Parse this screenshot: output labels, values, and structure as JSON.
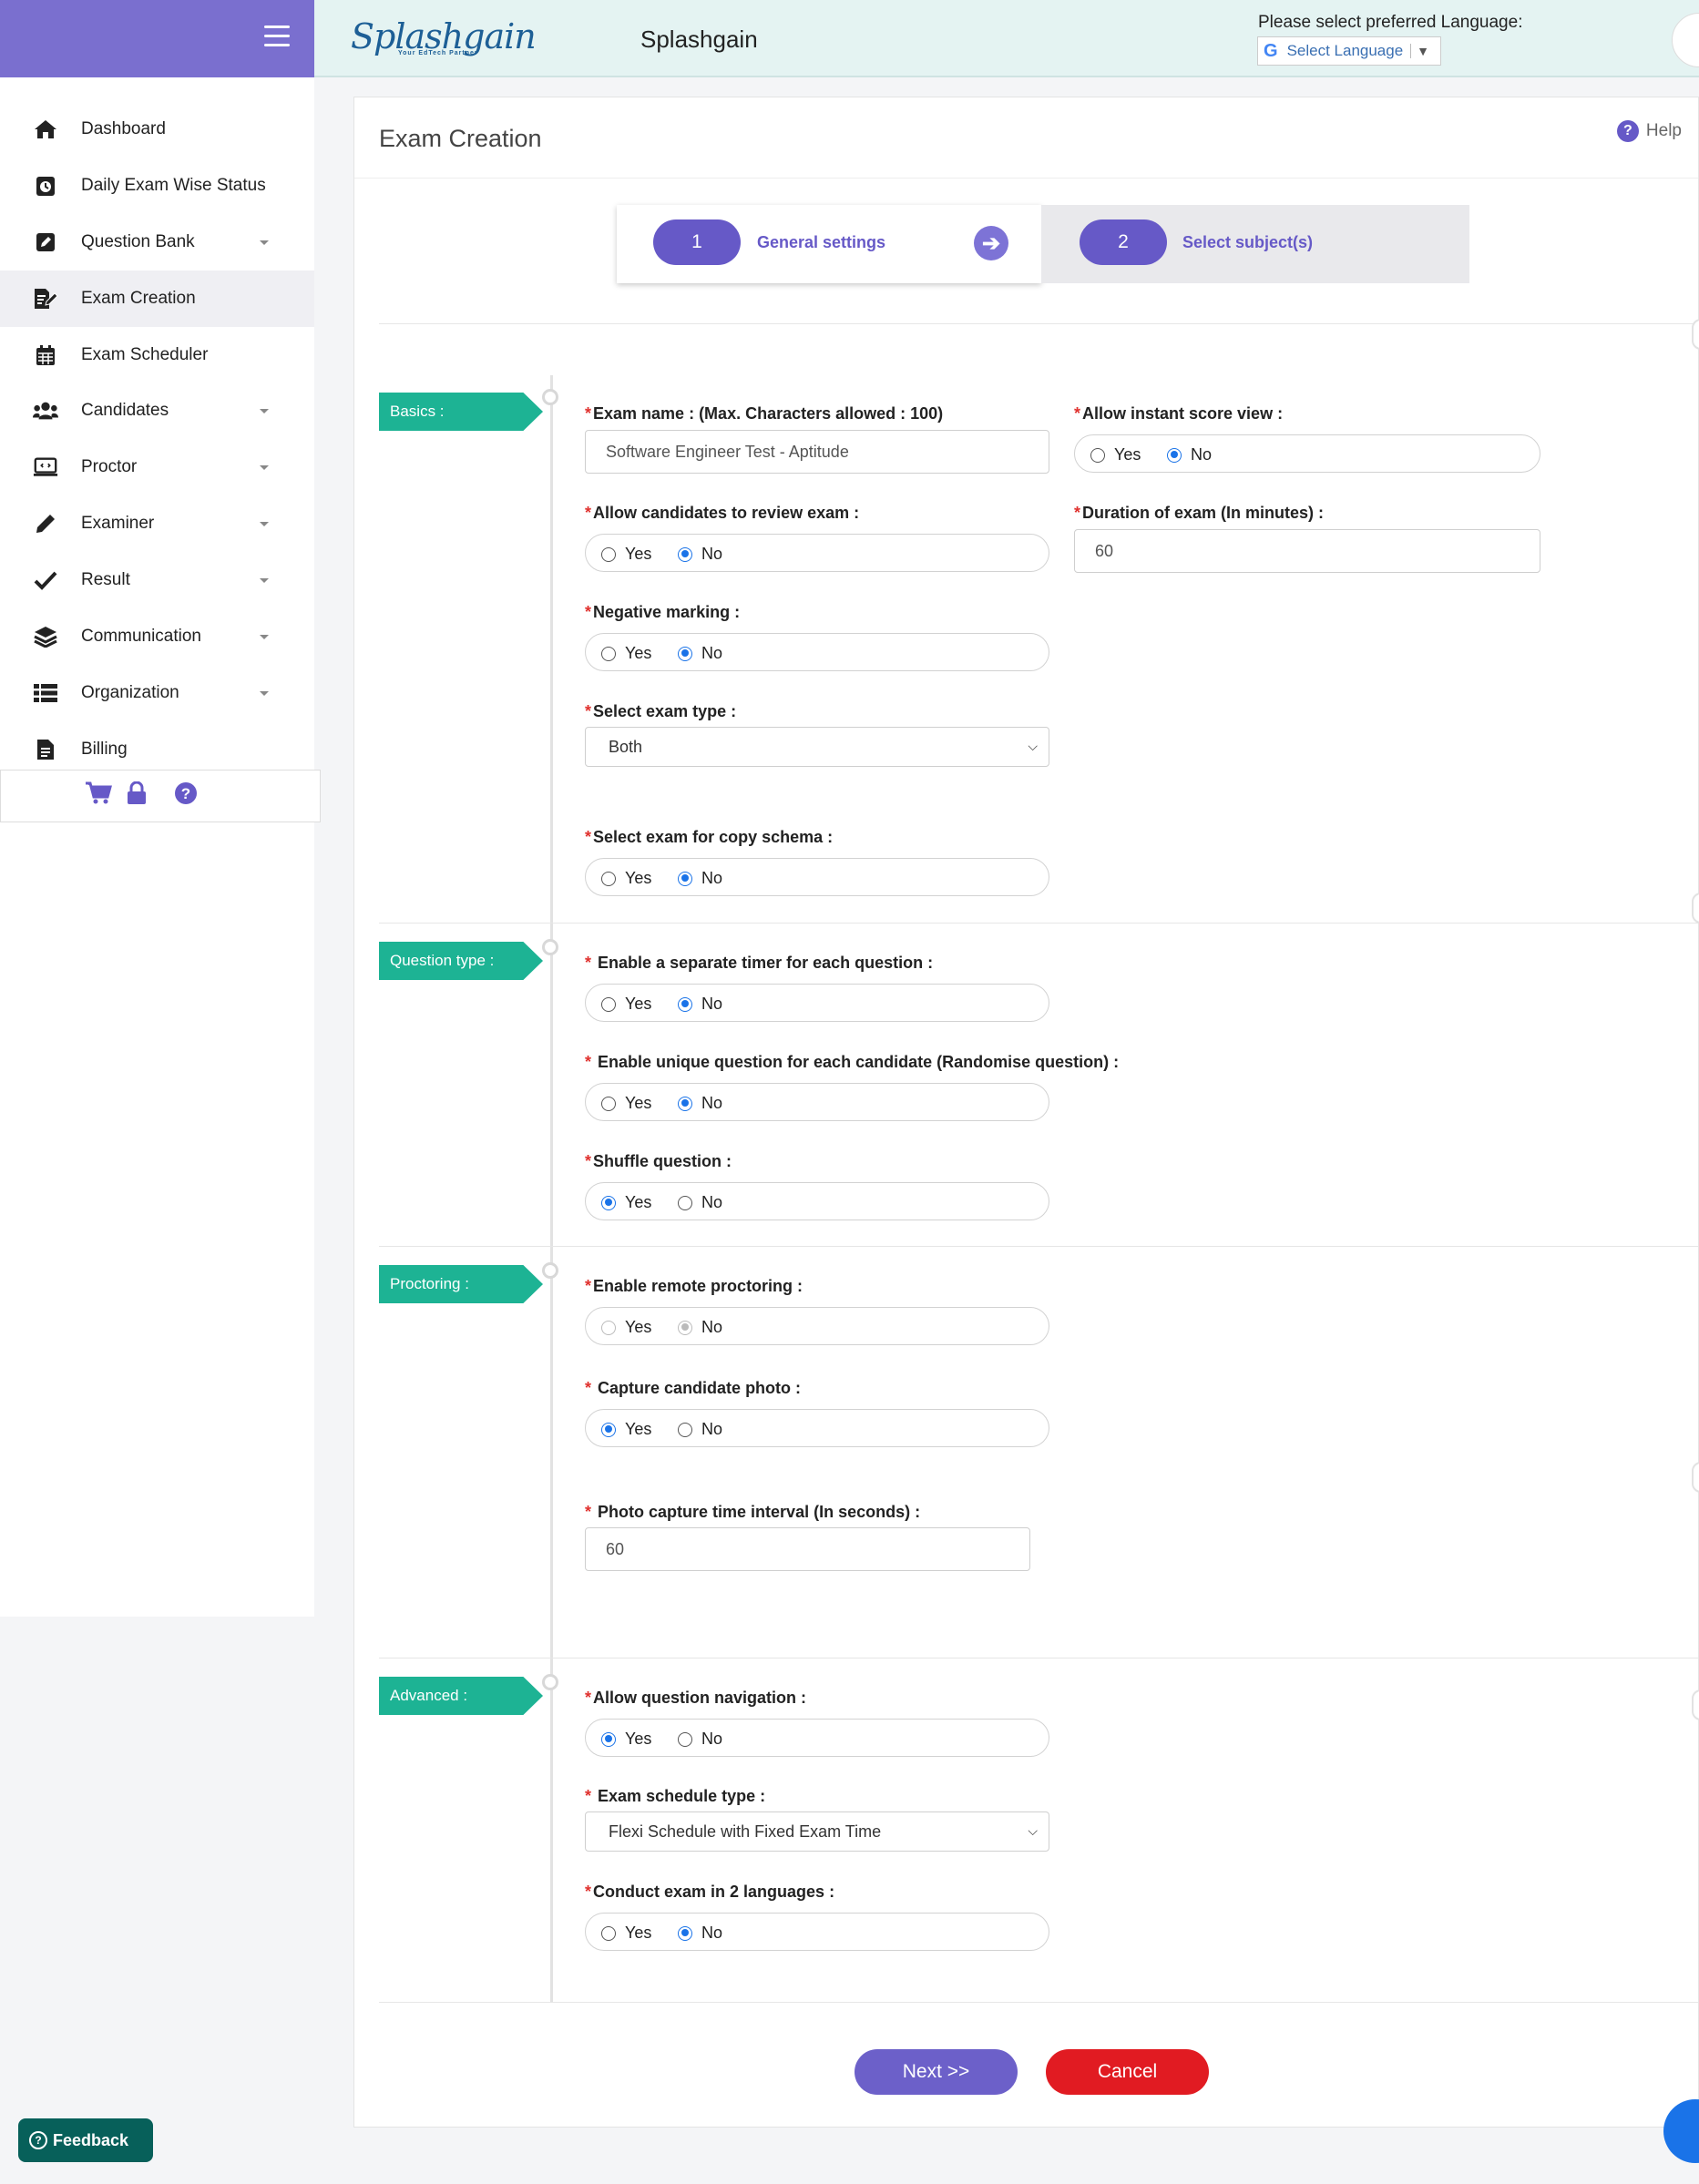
{
  "header": {
    "logo_text": "Splashgain",
    "logo_tagline": "Your EdTech Partner",
    "brand_name": "Splashgain",
    "language_prompt": "Please select preferred Language:",
    "language_select": "Select Language"
  },
  "sidebar": {
    "items": [
      {
        "label": "Dashboard",
        "icon": "home-icon"
      },
      {
        "label": "Daily Exam Wise Status",
        "icon": "clock-icon"
      },
      {
        "label": "Question Bank",
        "icon": "edit-square-icon"
      },
      {
        "label": "Exam Creation",
        "icon": "pen-paper-icon"
      },
      {
        "label": "Exam Scheduler",
        "icon": "calendar-icon"
      },
      {
        "label": "Candidates",
        "icon": "users-icon"
      },
      {
        "label": "Proctor",
        "icon": "monitor-icon"
      },
      {
        "label": "Examiner",
        "icon": "pencil-icon"
      },
      {
        "label": "Result",
        "icon": "check-icon"
      },
      {
        "label": "Communication",
        "icon": "layers-icon"
      },
      {
        "label": "Organization",
        "icon": "list-icon"
      },
      {
        "label": "Billing",
        "icon": "document-icon"
      }
    ],
    "footer_icons": [
      "cart-icon",
      "lock-icon",
      "question-icon"
    ]
  },
  "page": {
    "title": "Exam Creation",
    "help_label": "Help"
  },
  "wizard": {
    "step1": {
      "number": "1",
      "label": "General settings"
    },
    "step2": {
      "number": "2",
      "label": "Select subject(s)"
    }
  },
  "radio": {
    "yes": "Yes",
    "no": "No"
  },
  "sections": {
    "basics": "Basics :",
    "question_type": "Question type :",
    "proctoring": "Proctoring :",
    "advanced": "Advanced :"
  },
  "fields": {
    "exam_name": {
      "label": "Exam name : (Max. Characters allowed : 100)",
      "value": "Software Engineer Test - Aptitude"
    },
    "instant_score": {
      "label": "Allow instant score view :",
      "selected": "No"
    },
    "review_exam": {
      "label": "Allow candidates to review exam :",
      "selected": "No"
    },
    "duration": {
      "label": "Duration of exam (In minutes) :",
      "value": "60"
    },
    "negative_marking": {
      "label": "Negative marking :",
      "selected": "No"
    },
    "exam_type": {
      "label": "Select exam type :",
      "value": "Both"
    },
    "copy_schema": {
      "label": "Select exam for copy schema :",
      "selected": "No"
    },
    "separate_timer": {
      "label": "Enable a separate timer for each question :",
      "selected": "No"
    },
    "unique_question": {
      "label": "Enable unique question for each candidate (Randomise question) :",
      "selected": "No"
    },
    "shuffle": {
      "label": "Shuffle question :",
      "selected": "Yes"
    },
    "remote_proctoring": {
      "label": "Enable remote proctoring :",
      "selected": "No",
      "disabled": true
    },
    "capture_photo": {
      "label": "Capture candidate photo :",
      "selected": "Yes"
    },
    "photo_interval": {
      "label": "Photo capture time interval (In seconds) :",
      "value": "60"
    },
    "question_navigation": {
      "label": "Allow question navigation :",
      "selected": "Yes"
    },
    "schedule_type": {
      "label": "Exam schedule type :",
      "value": "Flexi Schedule with Fixed Exam Time"
    },
    "two_languages": {
      "label": "Conduct exam in 2 languages :",
      "selected": "No"
    }
  },
  "buttons": {
    "next": "Next >>",
    "cancel": "Cancel",
    "feedback": "Feedback"
  },
  "colors": {
    "accent": "#6659c7",
    "section_tag": "#1db394",
    "cancel": "#e11b22",
    "radio_checked": "#1a73e8"
  }
}
